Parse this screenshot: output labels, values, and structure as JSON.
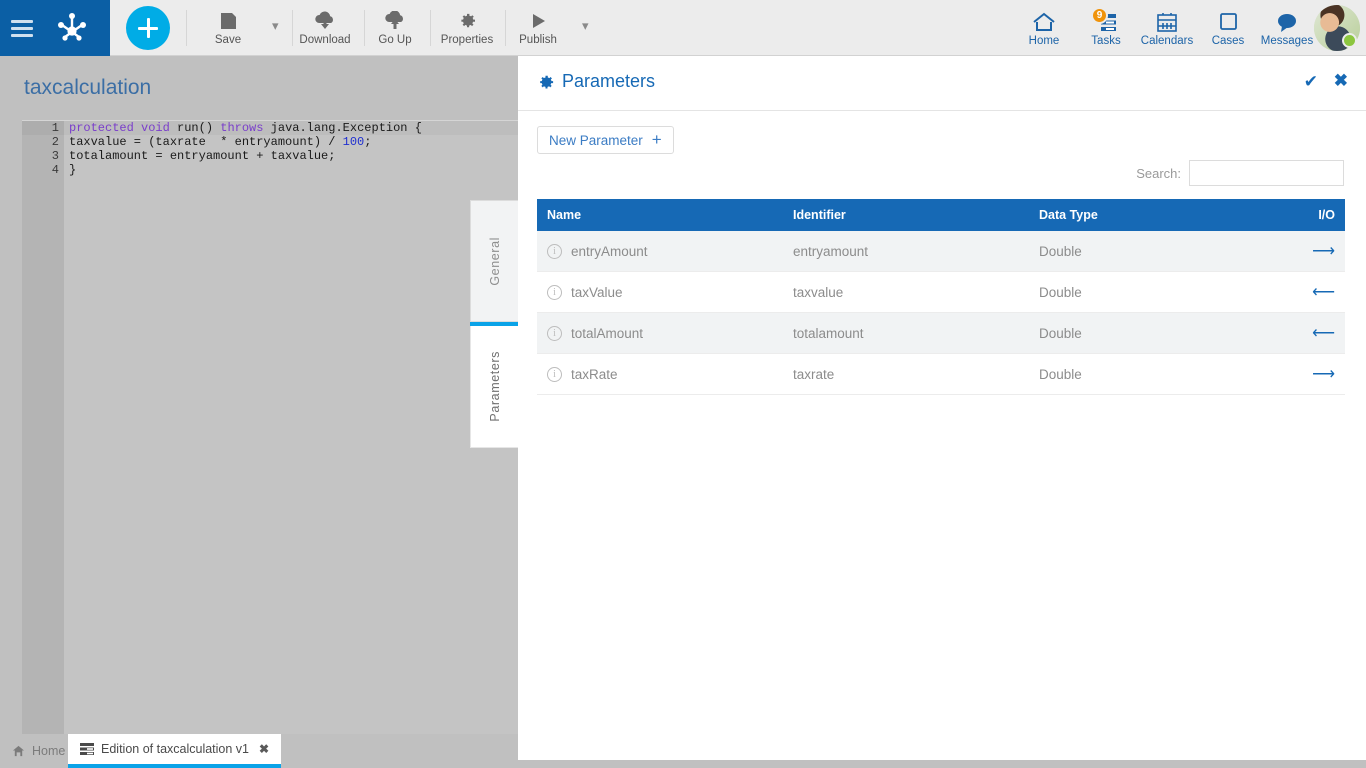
{
  "topbar": {
    "menu_icon": "hamburger-icon",
    "logo_icon": "bonita-paw-logo",
    "add_button_icon": "plus-icon",
    "tools": [
      {
        "label": "Save",
        "icon": "save-icon",
        "has_caret": true
      },
      {
        "label": "Download",
        "icon": "download-cloud-icon",
        "has_caret": false
      },
      {
        "label": "Go Up",
        "icon": "upload-cloud-icon",
        "has_caret": false
      },
      {
        "label": "Properties",
        "icon": "gear-icon",
        "has_caret": false
      },
      {
        "label": "Publish",
        "icon": "play-icon",
        "has_caret": true
      }
    ],
    "nav": [
      {
        "label": "Home",
        "icon": "home-icon",
        "badge": ""
      },
      {
        "label": "Tasks",
        "icon": "tasks-list-icon",
        "badge": "9"
      },
      {
        "label": "Calendars",
        "icon": "calendar-icon",
        "badge": ""
      },
      {
        "label": "Cases",
        "icon": "square-icon",
        "badge": ""
      },
      {
        "label": "Messages",
        "icon": "chat-bubble-icon",
        "badge": ""
      }
    ],
    "avatar": {
      "icon": "user-avatar",
      "status": "online",
      "status_color": "#8cc63f"
    }
  },
  "editor": {
    "document_title": "taxcalculation",
    "status_icon": "green-dot-status",
    "status_color": "#8ac33d",
    "line_numbers": [
      "1",
      "2",
      "3",
      "4"
    ],
    "code_lines": [
      {
        "segments": [
          {
            "text": "protected",
            "kind": "keyword"
          },
          {
            "text": " ",
            "kind": "plain"
          },
          {
            "text": "void",
            "kind": "keyword"
          },
          {
            "text": " run() ",
            "kind": "plain"
          },
          {
            "text": "throws",
            "kind": "keyword"
          },
          {
            "text": " java.lang.Exception {",
            "kind": "plain"
          }
        ]
      },
      {
        "segments": [
          {
            "text": "taxvalue = (taxrate  * entryamount) / ",
            "kind": "plain"
          },
          {
            "text": "100",
            "kind": "number"
          },
          {
            "text": ";",
            "kind": "plain"
          }
        ]
      },
      {
        "segments": [
          {
            "text": "totalamount = entryamount + taxvalue;",
            "kind": "plain"
          }
        ]
      },
      {
        "segments": [
          {
            "text": "}",
            "kind": "plain"
          }
        ]
      }
    ],
    "side_tabs": [
      {
        "label": "General",
        "active": false
      },
      {
        "label": "Parameters",
        "active": true
      }
    ]
  },
  "panel": {
    "title": "Parameters",
    "title_icon": "gear-icon",
    "accept_icon": "check-icon",
    "close_icon": "close-icon",
    "new_parameter_label": "New Parameter",
    "new_parameter_icon": "plus-icon",
    "search_label": "Search:",
    "search_value": "",
    "search_placeholder": "",
    "table": {
      "columns": [
        "Name",
        "Identifier",
        "Data Type",
        "I/O"
      ],
      "rows": [
        {
          "name": "entryAmount",
          "identifier": "entryamount",
          "data_type": "Double",
          "io": "⟶",
          "io_direction": "input"
        },
        {
          "name": "taxValue",
          "identifier": "taxvalue",
          "data_type": "Double",
          "io": "⟵",
          "io_direction": "output"
        },
        {
          "name": "totalAmount",
          "identifier": "totalamount",
          "data_type": "Double",
          "io": "⟵",
          "io_direction": "output"
        },
        {
          "name": "taxRate",
          "identifier": "taxrate",
          "data_type": "Double",
          "io": "⟶",
          "io_direction": "input"
        }
      ]
    }
  },
  "bottom_tabs": [
    {
      "label": "Home",
      "icon": "home-icon",
      "active": false,
      "closable": false
    },
    {
      "label": "Edition of taxcalculation v1",
      "icon": "list-icon",
      "active": true,
      "closable": true,
      "close_icon": "close-icon"
    }
  ],
  "colors": {
    "brand_blue": "#0b5fa5",
    "accent_cyan": "#00ace6",
    "header_blue": "#1669b5",
    "badge_orange": "#f0930a"
  }
}
